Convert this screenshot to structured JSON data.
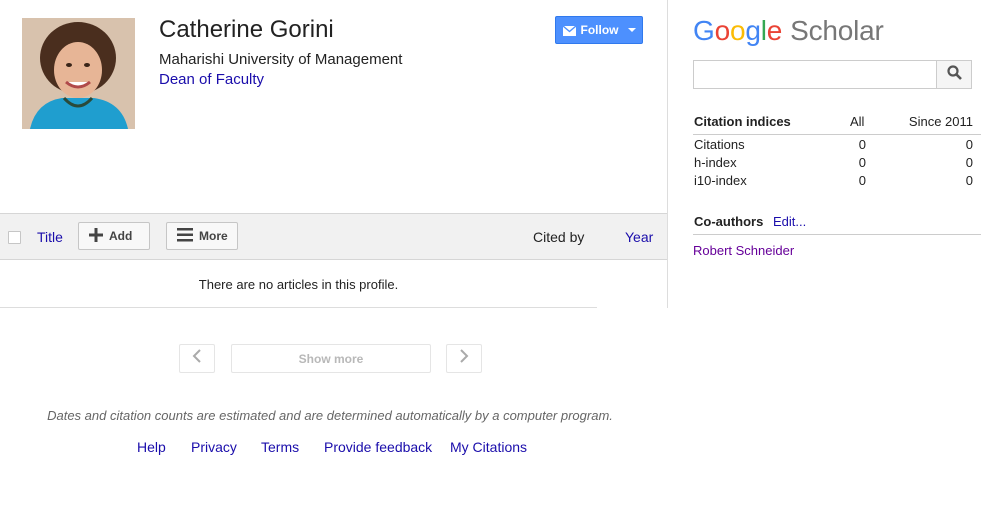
{
  "profile": {
    "name": "Catherine Gorini",
    "affiliation": "Maharishi University of Management",
    "role": "Dean of Faculty",
    "follow_label": "Follow"
  },
  "toolbar": {
    "title_label": "Title",
    "add_label": "Add",
    "more_label": "More",
    "cited_by_label": "Cited by",
    "year_label": "Year"
  },
  "articles": {
    "empty_message": "There are no articles in this profile."
  },
  "pagination": {
    "show_more_label": "Show more"
  },
  "disclaimer": "Dates and citation counts are estimated and are determined automatically by a computer program.",
  "footer": {
    "links": [
      "Help",
      "Privacy",
      "Terms",
      "Provide feedback",
      "My Citations"
    ]
  },
  "sidebar": {
    "logo_google": [
      "G",
      "o",
      "o",
      "g",
      "l",
      "e"
    ],
    "logo_scholar": "Scholar",
    "search": {
      "value": "",
      "placeholder": ""
    },
    "citation_indices": {
      "header": {
        "label": "Citation indices",
        "all": "All",
        "since": "Since 2011"
      },
      "rows": [
        {
          "label": "Citations",
          "all": "0",
          "since": "0"
        },
        {
          "label": "h-index",
          "all": "0",
          "since": "0"
        },
        {
          "label": "i10-index",
          "all": "0",
          "since": "0"
        }
      ]
    },
    "coauthors": {
      "label": "Co-authors",
      "edit_label": "Edit...",
      "items": [
        "Robert Schneider"
      ]
    }
  },
  "colors": {
    "link": "#1a0dab",
    "visited_link": "#660099",
    "follow_button": "#4d90fe",
    "google_blue": "#4285f4",
    "google_red": "#ea4335",
    "google_yellow": "#fbbc05",
    "google_green": "#34a853"
  },
  "icons": {
    "follow": "envelope-icon",
    "add": "plus-icon",
    "more": "hamburger-icon",
    "prev": "chevron-left-icon",
    "next": "chevron-right-icon",
    "search": "magnifier-icon"
  }
}
